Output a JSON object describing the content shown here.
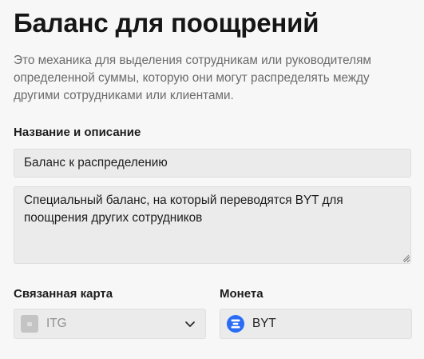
{
  "page": {
    "title": "Баланс для поощрений",
    "description": "Это механика для выделения сотрудникам или руководителям определенной суммы, которую они могут распределять между другими сотрудниками или клиентами."
  },
  "name_section": {
    "label": "Название и описание",
    "name_value": "Баланс к распределению",
    "description_value": "Специальный баланс, на который переводятся BYT для поощрения других сотрудников"
  },
  "linked_card": {
    "label": "Связанная карта",
    "selected": "ITG",
    "icon": "card-thumbnail-icon",
    "dropdown_icon": "chevron-down-icon"
  },
  "coin": {
    "label": "Монета",
    "value": "BYT",
    "icon": "coin-icon",
    "icon_color": "#2a6df4"
  }
}
